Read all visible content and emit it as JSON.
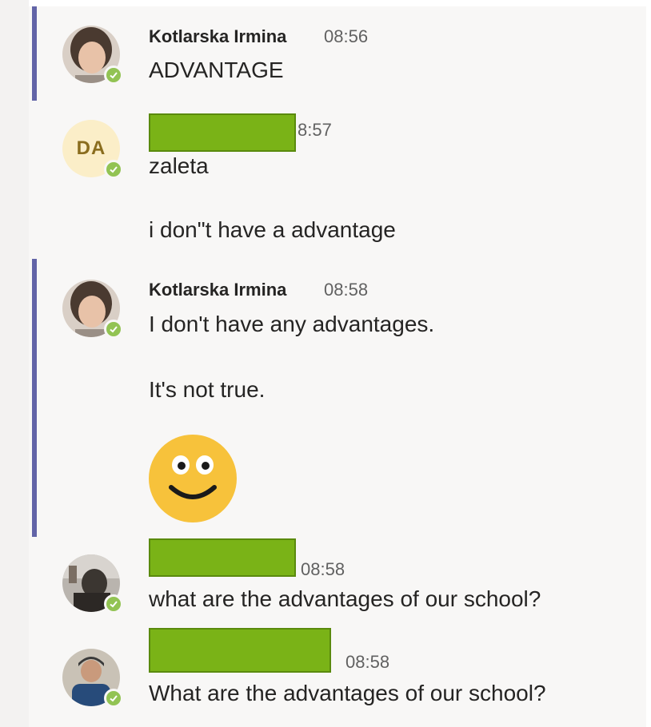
{
  "messages": [
    {
      "sender": "Kotlarska Irmina",
      "time": "08:56",
      "lines": [
        "ADVANTAGE"
      ]
    },
    {
      "avatar_initials": "DA",
      "time": "8:57",
      "lines": [
        "zaleta",
        "i don\"t have a advantage"
      ]
    },
    {
      "sender": "Kotlarska Irmina",
      "time": "08:58",
      "lines": [
        "I don't have any advantages.",
        "It's not true."
      ],
      "emoji": "smiley-emoji"
    },
    {
      "time": "08:58",
      "lines": [
        "what are the advantages of our school?"
      ]
    },
    {
      "time": "08:58",
      "lines": [
        "What are the advantages of our school?"
      ]
    }
  ],
  "colors": {
    "accent": "#6264a7",
    "presence": "#92c353",
    "redaction": "#7ab317"
  }
}
